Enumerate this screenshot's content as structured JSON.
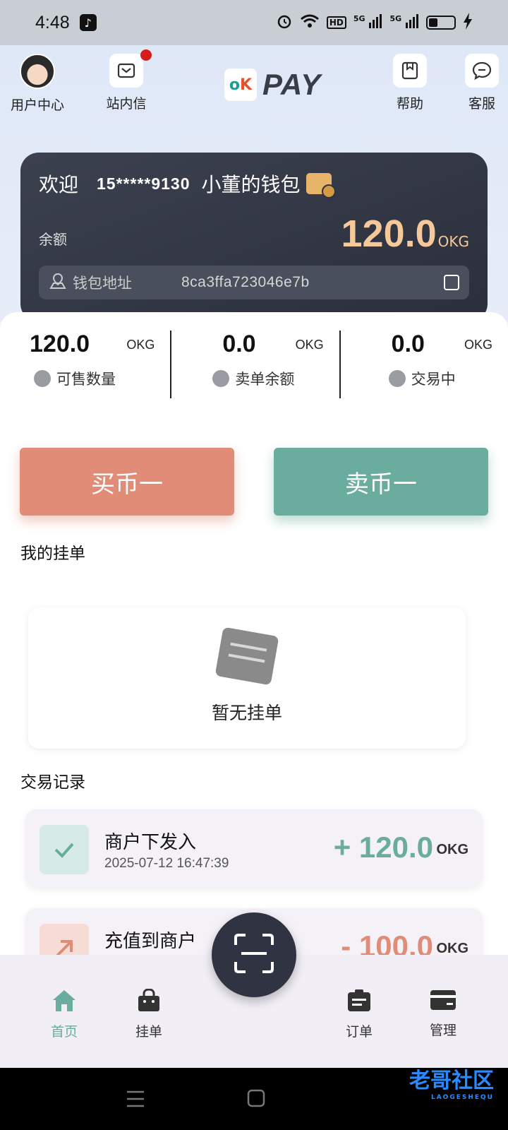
{
  "status_bar": {
    "time": "4:48",
    "network_1": "5G",
    "network_2": "5G",
    "hd": "HD"
  },
  "topnav": {
    "user_center": "用户中心",
    "messages": "站内信",
    "brand": {
      "mark": "OK",
      "text": "PAY"
    },
    "help": "帮助",
    "support": "客服"
  },
  "wallet": {
    "welcome": "欢迎",
    "phone": "15*****9130",
    "name": "小董的钱包",
    "balance_label": "余额",
    "balance": "120.0",
    "unit": "OKG",
    "address_label": "钱包地址",
    "address": "8ca3ffa723046e7b"
  },
  "stats": [
    {
      "value": "120.0",
      "unit": "OKG",
      "label": "可售数量"
    },
    {
      "value": "0.0",
      "unit": "OKG",
      "label": "卖单余额"
    },
    {
      "value": "0.0",
      "unit": "OKG",
      "label": "交易中"
    }
  ],
  "actions": {
    "buy": "买币一",
    "sell": "卖币一"
  },
  "my_orders": {
    "title": "我的挂单",
    "empty": "暂无挂单"
  },
  "records": {
    "title": "交易记录",
    "items": [
      {
        "title": "商户下发入",
        "time": "2025-07-12 16:47:39",
        "amount": "+ 120.0",
        "unit": "OKG",
        "color": "#6aac9d"
      },
      {
        "title": "充值到商户",
        "time": "",
        "amount": "- 100.0",
        "unit": "OKG",
        "color": "#e08c77"
      }
    ]
  },
  "bottomnav": {
    "home": "首页",
    "listing": "挂单",
    "orders": "订单",
    "manage": "管理"
  },
  "watermark": {
    "main": "老哥社区",
    "sub": "LAOGESHEQU"
  }
}
